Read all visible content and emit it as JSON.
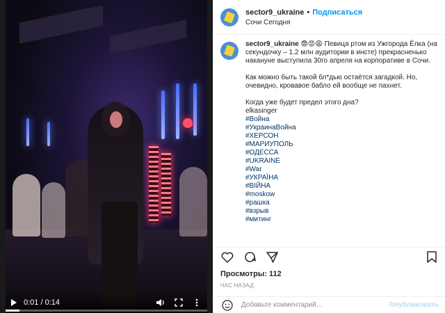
{
  "video": {
    "time_label": "0:01 / 0:14",
    "progress": 0.07
  },
  "post": {
    "username": "sector9_ukraine",
    "follow_label": "Подписаться",
    "location": "Сочи Сегодня",
    "caption_emojis": "😨😡😩",
    "paragraphs": [
      "Певица ртом из Ужгорода Ёлка (на секундочку – 1.2 млн аудитории в инсте) прекрасненько накануне выступила 30го апреля на корпоративе в Сочи.",
      "Как можно быть такой бл*дью остаётся загадкой. Но, очевидно, кровавое бабло ей вообще не пахнет."
    ],
    "question": "Когда уже будет предел этого дна?",
    "mention": "elkasinger",
    "hashtags": [
      "#Война",
      "#УкраинаВойна",
      "#ХЕРСОН",
      "#МАРИУПОЛЬ",
      "#ОДЕССА",
      "#UKRAINE",
      "#War",
      "#УКРАЇНА",
      "#ВІЙНА",
      "#moskow",
      "#рашка",
      "#взрыв",
      "#митинг"
    ]
  },
  "stats": {
    "views_label": "Просмотры: 112",
    "time_ago": "ЧАС НАЗАД"
  },
  "comment": {
    "placeholder": "Добавьте комментарий...",
    "publish_label": "Опубликовать"
  }
}
